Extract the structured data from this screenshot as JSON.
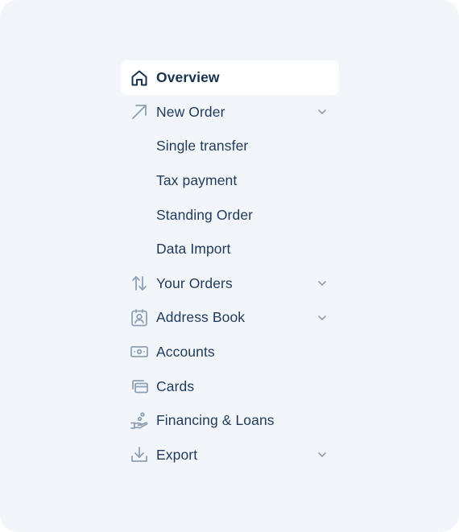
{
  "theme": {
    "panel_bg": "#f2f5f9",
    "active_bg": "#ffffff",
    "text_color": "#1f3a5a",
    "icon_color": "#8ea1b4",
    "active_icon_color": "#17324f"
  },
  "nav": {
    "items": [
      {
        "label": "Overview",
        "icon": "home-icon",
        "active": true
      },
      {
        "label": "New Order",
        "icon": "arrow-up-right-icon",
        "expandable": true
      },
      {
        "label": "Single transfer",
        "sub": true
      },
      {
        "label": "Tax payment",
        "sub": true
      },
      {
        "label": "Standing Order",
        "sub": true
      },
      {
        "label": "Data Import",
        "sub": true
      },
      {
        "label": "Your Orders",
        "icon": "arrows-up-down-icon",
        "expandable": true
      },
      {
        "label": "Address Book",
        "icon": "contact-card-icon",
        "expandable": true
      },
      {
        "label": "Accounts",
        "icon": "banknote-icon"
      },
      {
        "label": "Cards",
        "icon": "credit-cards-icon"
      },
      {
        "label": "Financing & Loans",
        "icon": "hand-coin-icon"
      },
      {
        "label": "Export",
        "icon": "download-icon",
        "expandable": true
      }
    ]
  }
}
